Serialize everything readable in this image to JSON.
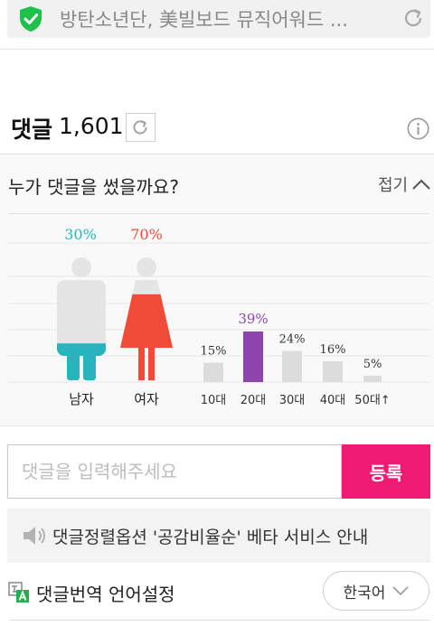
{
  "urlbar": {
    "title": "방탄소년단, 美빌보드 뮤직어워드 ...",
    "secure_icon": "shield-check-icon",
    "reload_icon": "reload-icon"
  },
  "comments": {
    "label": "댓글",
    "count": "1,601",
    "refresh_icon": "refresh-icon",
    "info_icon": "info-icon"
  },
  "stats": {
    "question": "누가 댓글을 썼을까요?",
    "collapse_label": "접기",
    "gender": [
      {
        "label": "남자",
        "percent_label": "30%",
        "value": 30,
        "color": "#27b4bd"
      },
      {
        "label": "여자",
        "percent_label": "70%",
        "value": 70,
        "color": "#f04b37"
      }
    ],
    "age": [
      {
        "label": "10대",
        "percent_label": "15%",
        "value": 15,
        "highlight": false
      },
      {
        "label": "20대",
        "percent_label": "39%",
        "value": 39,
        "highlight": true
      },
      {
        "label": "30대",
        "percent_label": "24%",
        "value": 24,
        "highlight": false
      },
      {
        "label": "40대",
        "percent_label": "16%",
        "value": 16,
        "highlight": false
      },
      {
        "label": "50대↑",
        "percent_label": "5%",
        "value": 5,
        "highlight": false
      }
    ],
    "colors": {
      "highlight": "#8e44ad",
      "bar": "#dcdcdc",
      "male": "#27b4bd",
      "female": "#f04b37"
    }
  },
  "input": {
    "placeholder": "댓글을 입력해주세요",
    "value": "",
    "submit_label": "등록",
    "submit_color": "#ee1a73"
  },
  "notice": {
    "icon": "speaker-icon",
    "text": "댓글정렬옵션 '공감비율순' 베타 서비스 안내"
  },
  "translation": {
    "icon": "translate-icon",
    "label": "댓글번역 언어설정",
    "selected_language": "한국어"
  }
}
